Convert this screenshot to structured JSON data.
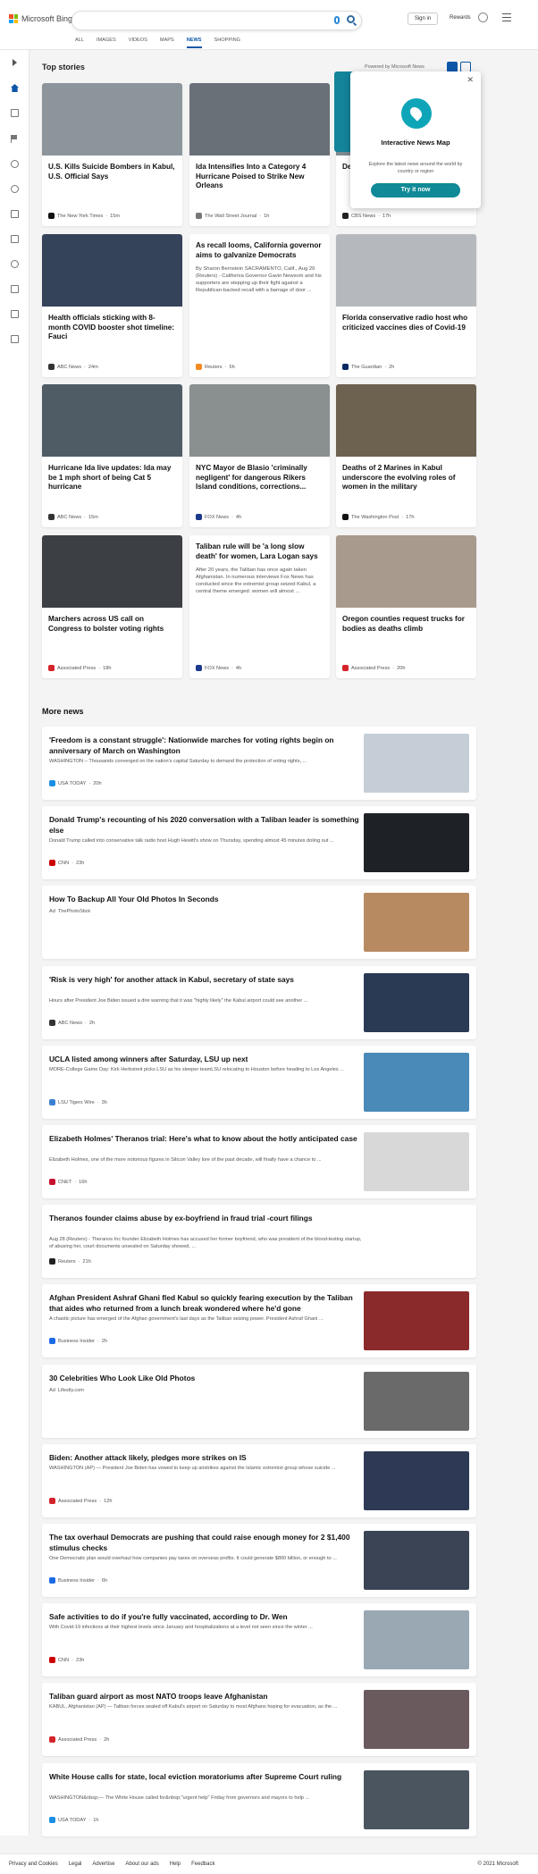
{
  "header": {
    "brand": "Microsoft Bing",
    "signin": "Sign in",
    "rewards": "Rewards",
    "tabs": [
      "ALL",
      "IMAGES",
      "VIDEOS",
      "MAPS",
      "NEWS",
      "SHOPPING"
    ],
    "active_tab": "NEWS"
  },
  "top_stories": {
    "heading": "Top stories",
    "powered_by": "Powered by Microsoft News",
    "cards": [
      {
        "title": "U.S. Kills Suicide Bombers in Kabul, U.S. Official Says",
        "summary": "",
        "source": "The New York Times",
        "time": "15m",
        "img": "#8d959c",
        "icon": "#111111"
      },
      {
        "title": "Ida Intensifies Into a Category 4 Hurricane Poised to Strike New Orleans",
        "summary": "",
        "source": "The Wall Street Journal",
        "time": "1h",
        "img": "#6a7078",
        "icon": "#777777"
      },
      {
        "title": "Delta hosp unva",
        "summary": "",
        "source": "CBS News",
        "time": "17h",
        "img": "#7d8a90",
        "icon": "#222222"
      },
      {
        "title": "Health officials sticking with 8-month COVID booster shot timeline: Fauci",
        "summary": "",
        "source": "ABC News",
        "time": "24m",
        "img": "#34425a",
        "icon": "#333333"
      },
      {
        "title": "As recall looms, California governor aims to galvanize Democrats",
        "summary": "By Sharon Bernstein SACRAMENTO, Calif., Aug 29 (Reuters) - California Governor Gavin Newsom and his supporters are stepping up their fight against a Republican-backed recall with a barrage of door ...",
        "source": "Reuters",
        "time": "6h",
        "img": "",
        "icon": "#f08a24"
      },
      {
        "title": "Florida conservative radio host who criticized vaccines dies of Covid-19",
        "summary": "",
        "source": "The Guardian",
        "time": "2h",
        "img": "#b5b9bd",
        "icon": "#052962"
      },
      {
        "title": "Hurricane Ida live updates: Ida may be 1 mph short of being Cat 5 hurricane",
        "summary": "",
        "source": "ABC News",
        "time": "15m",
        "img": "#4f5c66",
        "icon": "#333333"
      },
      {
        "title": "NYC Mayor de Blasio 'criminally negligent' for dangerous Rikers Island conditions, corrections...",
        "summary": "",
        "source": "FOX News",
        "time": "4h",
        "img": "#8a8f90",
        "icon": "#1b3a8c"
      },
      {
        "title": "Deaths of 2 Marines in Kabul underscore the evolving roles of women in the military",
        "summary": "",
        "source": "The Washington Post",
        "time": "17h",
        "img": "#6d6150",
        "icon": "#111111"
      },
      {
        "title": "Marchers across US call on Congress to bolster voting rights",
        "summary": "",
        "source": "Associated Press",
        "time": "18h",
        "img": "#3c3f44",
        "icon": "#d4232b"
      },
      {
        "title": "Taliban rule will be 'a long slow death' for women, Lara Logan says",
        "summary": "After 20 years, the Taliban has once again taken Afghanistan. In numerous interviews Fox News has conducted since the extremist group seized Kabul, a central theme emerged: women will almost ...",
        "source": "FOX News",
        "time": "4h",
        "img": "",
        "icon": "#1b3a8c"
      },
      {
        "title": "Oregon counties request trucks for bodies as deaths climb",
        "summary": "",
        "source": "Associated Press",
        "time": "20h",
        "img": "#a89a8c",
        "icon": "#d4232b"
      }
    ]
  },
  "popup": {
    "title": "Interactive News Map",
    "desc": "Explore the latest news around the world by country or region",
    "button": "Try it now"
  },
  "more_news": {
    "heading": "More news",
    "items": [
      {
        "title": "'Freedom is a constant struggle': Nationwide marches for voting rights begin on anniversary of March on Washington",
        "desc": "WASHINGTON – Thousands converged on the nation's capital Saturday to demand the protection of voting rights, ...",
        "source": "USA TODAY",
        "time": "20h",
        "img": "#c5ced6",
        "icon": "#1a8fe3"
      },
      {
        "title": "Donald Trump's recounting of his 2020 conversation with a Taliban leader is something else",
        "desc": "Donald Trump called into conservative talk radio host Hugh Hewitt's show on Thursday, spending almost 45 minutes doling out ...",
        "source": "CNN",
        "time": "23h",
        "img": "#1e2126",
        "icon": "#cc0000"
      },
      {
        "title": "How To Backup All Your Old Photos In Seconds",
        "desc": "",
        "source": "ThePhotoStick",
        "time": "",
        "ad": "Ad",
        "img": "#b88a62",
        "icon": ""
      },
      {
        "title": "'Risk is very high' for another attack in Kabul, secretary of state says",
        "desc": "Hours after President Joe Biden issued a dire warning that it was \"highly likely\" the Kabul airport could see another ...",
        "source": "ABC News",
        "time": "2h",
        "img": "#2a3a55",
        "icon": "#333333"
      },
      {
        "title": "UCLA listed among winners after Saturday, LSU up next",
        "desc": "MORE-College Game Day: Kirk Herbstreit picks LSU as his sleeper teamLSU relocating to Houston before heading to Los Angeles ...",
        "source": "LSU Tigers Wire",
        "time": "3h",
        "img": "#4a8ab8",
        "icon": "#3a7fd0"
      },
      {
        "title": "Elizabeth Holmes' Theranos trial: Here's what to know about the hotly anticipated case",
        "desc": "Elizabeth Holmes, one of the more notorious figures in Silicon Valley lore of the past decade, will finally have a chance to ...",
        "source": "CNET",
        "time": "16h",
        "img": "#d8d8d8",
        "icon": "#c8102e"
      },
      {
        "title": "Theranos founder claims abuse by ex-boyfriend in fraud trial -court filings",
        "desc": "Aug 28 (Reuters) - Theranos Inc founder Elizabeth Holmes has accused her former boyfriend, who was president of the blood-testing startup, of abusing her, court documents unsealed on Saturday showed, ...",
        "source": "Reuters",
        "time": "21h",
        "img": "",
        "icon": "#222222"
      },
      {
        "title": "Afghan President Ashraf Ghani fled Kabul so quickly fearing execution by the Taliban that aides who returned from a lunch break wondered where he'd gone",
        "desc": "A chaotic picture has emerged of the Afghan government's last days as the Taliban seizing power. President Ashraf Ghani ...",
        "source": "Business Insider",
        "time": "2h",
        "img": "#8a2a2a",
        "icon": "#1d6ae5"
      },
      {
        "title": "30 Celebrities Who Look Like Old Photos",
        "desc": "",
        "source": "Lifestly.com",
        "time": "",
        "ad": "Ad",
        "img": "#6a6a6a",
        "icon": ""
      },
      {
        "title": "Biden: Another attack likely, pledges more strikes on IS",
        "desc": "WASHINGTON (AP) — President Joe Biden has vowed to keep up airstrikes against the Islamic extremist group whose suicide ...",
        "source": "Associated Press",
        "time": "12h",
        "img": "#2e3a55",
        "icon": "#d4232b"
      },
      {
        "title": "The tax overhaul Democrats are pushing that could raise enough money for 2 $1,400 stimulus checks",
        "desc": "One Democratic plan would overhaul how companies pay taxes on overseas profits. It could generate $800 billion, or enough to ...",
        "source": "Business Insider",
        "time": "6h",
        "img": "#3a4455",
        "icon": "#1d6ae5"
      },
      {
        "title": "Safe activities to do if you're fully vaccinated, according to Dr. Wen",
        "desc": "With Covid-19 infections at their highest levels since January and hospitalizations at a level not seen since the winter ...",
        "source": "CNN",
        "time": "23h",
        "img": "#9aa8b4",
        "icon": "#cc0000"
      },
      {
        "title": "Taliban guard airport as most NATO troops leave Afghanistan",
        "desc": "KABUL, Afghanistan (AP) — Taliban forces sealed off Kabul's airport on Saturday to most Afghans hoping for evacuation, as the ...",
        "source": "Associated Press",
        "time": "2h",
        "img": "#6a5a5e",
        "icon": "#d4232b"
      },
      {
        "title": "White House calls for state, local eviction moratoriums after Supreme Court ruling",
        "desc": "WASHINGTON&nbsp;— The White House called for&nbsp;\"urgent help\" Friday from governors and mayors to help ...",
        "source": "USA TODAY",
        "time": "1h",
        "img": "#4a5560",
        "icon": "#1a8fe3"
      }
    ]
  },
  "footer": {
    "links": [
      "Privacy and Cookies",
      "Legal",
      "Advertise",
      "About our ads",
      "Help",
      "Feedback"
    ],
    "copyright": "© 2021 Microsoft"
  }
}
